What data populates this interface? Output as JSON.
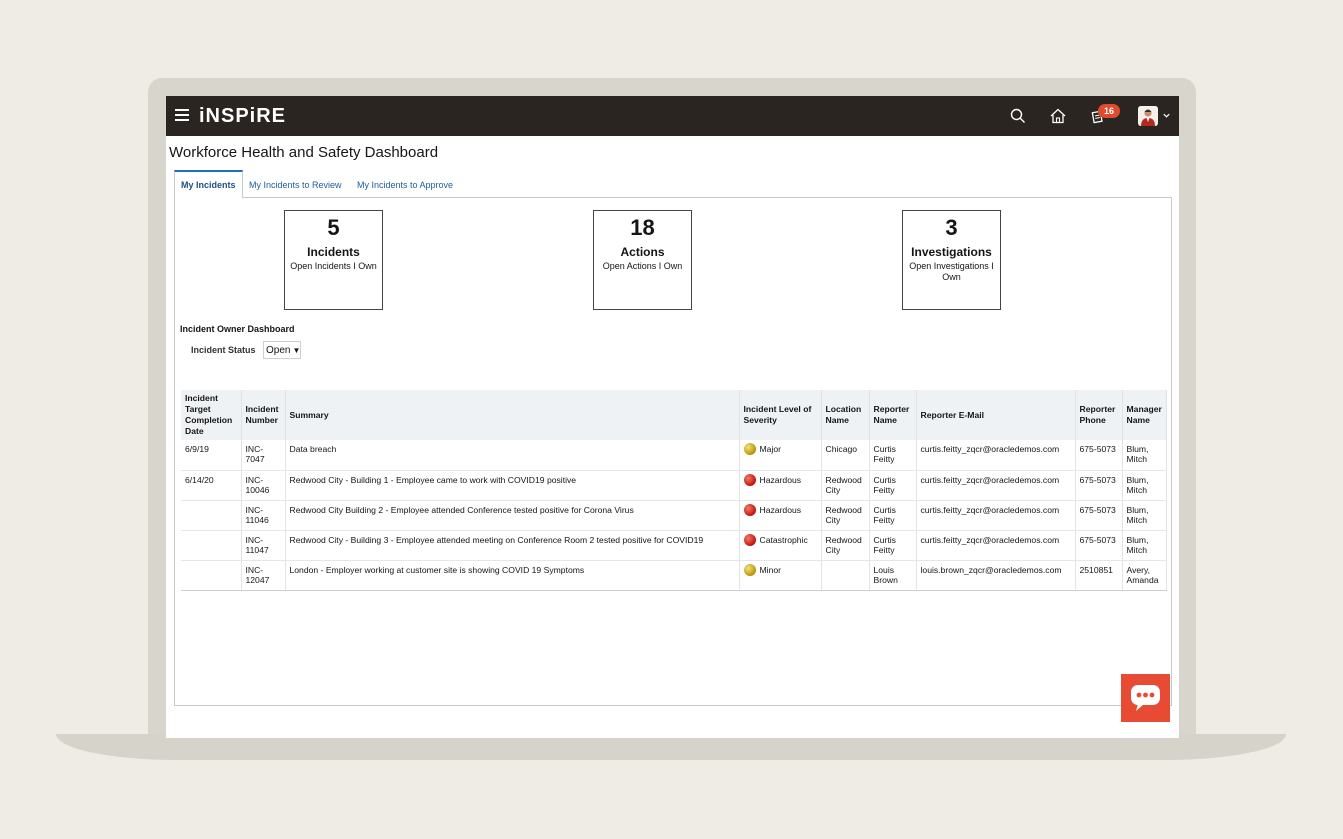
{
  "app": {
    "brand": "iNSPiRE",
    "notification_count": "16"
  },
  "page": {
    "title": "Workforce Health and Safety Dashboard"
  },
  "tabs": [
    {
      "label": "My Incidents",
      "active": true
    },
    {
      "label": "My Incidents to Review",
      "active": false
    },
    {
      "label": "My Incidents to Approve",
      "active": false
    }
  ],
  "metrics": [
    {
      "number": "5",
      "label": "Incidents",
      "sub": "Open Incidents I Own"
    },
    {
      "number": "18",
      "label": "Actions",
      "sub": "Open Actions I Own"
    },
    {
      "number": "3",
      "label": "Investigations",
      "sub": "Open Investigations I Own"
    }
  ],
  "dashboard": {
    "title": "Incident Owner Dashboard",
    "status_label": "Incident Status",
    "status_value": "Open"
  },
  "table": {
    "columns": [
      "Incident Target Completion Date",
      "Incident Number",
      "Summary",
      "Incident Level of Severity",
      "Location Name",
      "Reporter Name",
      "Reporter E-Mail",
      "Reporter Phone",
      "Manager Name"
    ],
    "rows": [
      {
        "date": "6/9/19",
        "number": "INC-7047",
        "summary": "Data breach",
        "severity": "Major",
        "severity_color": "#c9a20c",
        "location": "Chicago",
        "reporter": "Curtis Feitty",
        "email": "curtis.feitty_zqcr@oracledemos.com",
        "phone": "675-5073",
        "manager": "Blum, Mitch"
      },
      {
        "date": "6/14/20",
        "number": "INC-10046",
        "summary": "Redwood City - Building 1 - Employee came to work with COVID19 positive",
        "severity": "Hazardous",
        "severity_color": "#c4120a",
        "location": "Redwood City",
        "reporter": "Curtis Feitty",
        "email": "curtis.feitty_zqcr@oracledemos.com",
        "phone": "675-5073",
        "manager": "Blum, Mitch"
      },
      {
        "date": "",
        "number": "INC-11046",
        "summary": "Redwood City Building 2 - Employee attended Conference tested positive for Corona Virus",
        "severity": "Hazardous",
        "severity_color": "#c4120a",
        "location": "Redwood City",
        "reporter": "Curtis Feitty",
        "email": "curtis.feitty_zqcr@oracledemos.com",
        "phone": "675-5073",
        "manager": "Blum, Mitch"
      },
      {
        "date": "",
        "number": "INC-11047",
        "summary": "Redwood City - Building 3 - Employee attended meeting on Conference Room 2 tested positive for COVID19",
        "severity": "Catastrophic",
        "severity_color": "#c4120a",
        "location": "Redwood City",
        "reporter": "Curtis Feitty",
        "email": "curtis.feitty_zqcr@oracledemos.com",
        "phone": "675-5073",
        "manager": "Blum, Mitch"
      },
      {
        "date": "",
        "number": "INC-12047",
        "summary": "London - Employer working at customer site is showing COVID 19 Symptoms",
        "severity": "Minor",
        "severity_color": "#c9a20c",
        "location": "",
        "reporter": "Louis Brown",
        "email": "louis.brown_zqcr@oracledemos.com",
        "phone": "2510851",
        "manager": "Avery, Amanda"
      }
    ]
  },
  "colors": {
    "topbar": "#2b2521",
    "accent": "#1f6fbf",
    "chat": "#e84b33"
  }
}
